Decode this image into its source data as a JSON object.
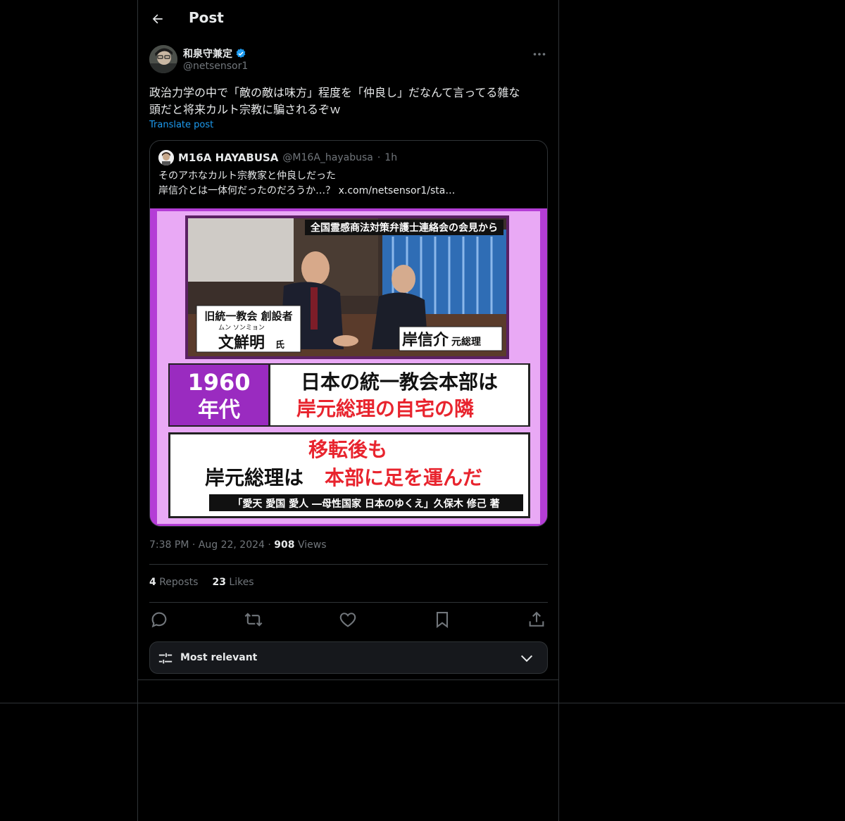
{
  "header": {
    "title": "Post"
  },
  "post": {
    "author_name": "和泉守兼定",
    "author_handle": "@netsensor1",
    "text_line1": "政治力学の中で「敵の敵は味方」程度を「仲良し」だなんて言ってる雑な",
    "text_line2": "頭だと将来カルト宗教に騙されるぞｗ",
    "translate_label": "Translate post",
    "time": "7:38 PM",
    "date": "Aug 22, 2024",
    "views_count": "908",
    "views_label": "Views",
    "reposts_count": "4",
    "reposts_label": "Reposts",
    "likes_count": "23",
    "likes_label": "Likes"
  },
  "quote": {
    "name": "M16A HAYABUSA",
    "handle": "@M16A_hayabusa",
    "dot": "·",
    "age": "1h",
    "line1": "そのアホなカルト宗教家と仲良しだった",
    "line2": "岸信介とは一体何だったのだろうか…？",
    "link": "x.com/netsensor1/sta…",
    "image": {
      "top_caption": "全国霊感商法対策弁護士連絡会の会見から",
      "left_label_1": "旧統一教会 創設者",
      "left_ruby": "ムン ソンミョン",
      "left_name": "文鮮明",
      "left_suffix": "氏",
      "right_name": "岸信介",
      "right_suffix": "元総理",
      "year_top": "1960",
      "year_bottom": "年代",
      "box1_line1": "日本の統一教会本部は",
      "box1_line2": "岸元総理の自宅の隣",
      "box2_line1": "移転後も",
      "box2_line2a": "岸元総理は",
      "box2_line2b": "本部に足を運んだ",
      "source": "「愛天 愛国 愛人 ―母性国家 日本のゆくえ」久保木 修己 著"
    }
  },
  "sort": {
    "label": "Most relevant"
  },
  "colors": {
    "accent": "#1d9bf0",
    "image_frame": "#b43dd6",
    "red_text": "#e8242e"
  }
}
